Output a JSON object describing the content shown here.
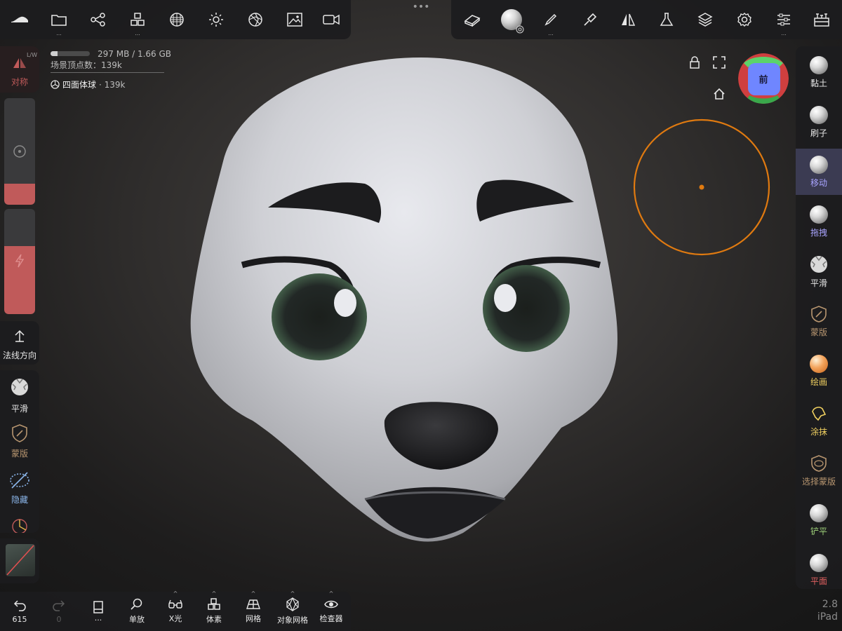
{
  "top_toolbar_left": {
    "tools": [
      {
        "icon": "nomad-logo-icon",
        "dots": ""
      },
      {
        "icon": "folder-icon",
        "dots": "..."
      },
      {
        "icon": "scene-graph-icon",
        "dots": ""
      },
      {
        "icon": "primitives-icon",
        "dots": "..."
      },
      {
        "icon": "topology-icon",
        "dots": ""
      },
      {
        "icon": "lighting-icon",
        "dots": ""
      },
      {
        "icon": "shading-icon",
        "dots": ""
      },
      {
        "icon": "background-image-icon",
        "dots": ""
      },
      {
        "icon": "video-record-icon",
        "dots": ""
      }
    ]
  },
  "top_center_handle": "•••",
  "top_toolbar_right": {
    "tools": [
      {
        "icon": "eraser-icon",
        "dots": ""
      },
      {
        "icon": "active-brush-icon",
        "dots": ""
      },
      {
        "icon": "paint-brush-icon",
        "dots": "..."
      },
      {
        "icon": "stroke-icon",
        "dots": ""
      },
      {
        "icon": "symmetry-icon",
        "dots": ""
      },
      {
        "icon": "flask-icon",
        "dots": ""
      },
      {
        "icon": "layers-icon",
        "dots": ""
      },
      {
        "icon": "settings-icon",
        "dots": ""
      },
      {
        "icon": "sliders-icon",
        "dots": "..."
      },
      {
        "icon": "interface-icon",
        "dots": ""
      }
    ]
  },
  "stats": {
    "memory": "297 MB / 1.66 GB",
    "memory_fill": 0.18,
    "scene_vertices": "场景顶点数：139k",
    "object_name": "四面体球",
    "object_vertices": "· 139k"
  },
  "left_panel": {
    "symmetry_label": "对称",
    "symmetry_corner": "L/W",
    "radius_fill": 0.2,
    "intensity_fill": 0.65,
    "normal_label": "法线方向",
    "quick_tools": [
      {
        "label": "平滑",
        "color": "#e8e8e8"
      },
      {
        "label": "蒙版",
        "color": "#b89670"
      },
      {
        "label": "隐藏",
        "color": "#8ab4e8"
      }
    ]
  },
  "right_tools": [
    {
      "label": "黏土",
      "color": "#e8e8e8",
      "active": false
    },
    {
      "label": "刷子",
      "color": "#e8e8e8",
      "active": false
    },
    {
      "label": "移动",
      "color": "#a9a4ff",
      "active": true
    },
    {
      "label": "拖拽",
      "color": "#a9a4ff",
      "active": false
    },
    {
      "label": "平滑",
      "color": "#e8e8e8",
      "active": false
    },
    {
      "label": "蒙版",
      "color": "#b89670",
      "active": false
    },
    {
      "label": "绘画",
      "color": "#f0d060",
      "active": false
    },
    {
      "label": "涂抹",
      "color": "#f0d060",
      "active": false
    },
    {
      "label": "选择蒙版",
      "color": "#b89670",
      "active": false
    },
    {
      "label": "铲平",
      "color": "#9fd27a",
      "active": false
    },
    {
      "label": "平面",
      "color": "#e06060",
      "active": false
    }
  ],
  "view_cube": {
    "face_label": "前",
    "colors": {
      "top": "#5bd36b",
      "side": "#cf3f3f",
      "front": "#6f86ff"
    }
  },
  "bottom_toolbar": {
    "undo_count": "615",
    "redo_count": "0",
    "items": [
      {
        "label": "...",
        "icon": "document-icon"
      },
      {
        "label": "单放",
        "icon": "search-icon"
      },
      {
        "label": "X光",
        "icon": "glasses-icon"
      },
      {
        "label": "体素",
        "icon": "voxel-icon"
      },
      {
        "label": "网格",
        "icon": "grid-icon"
      },
      {
        "label": "对象网格",
        "icon": "wireframe-icon"
      },
      {
        "label": "检查器",
        "icon": "eye-icon"
      }
    ]
  },
  "version": {
    "number": "2.8",
    "device": "iPad"
  },
  "colors": {
    "accent_red": "#c05a5a",
    "brush_cursor": "#e07a10",
    "active_tool": "#a9a4ff"
  }
}
